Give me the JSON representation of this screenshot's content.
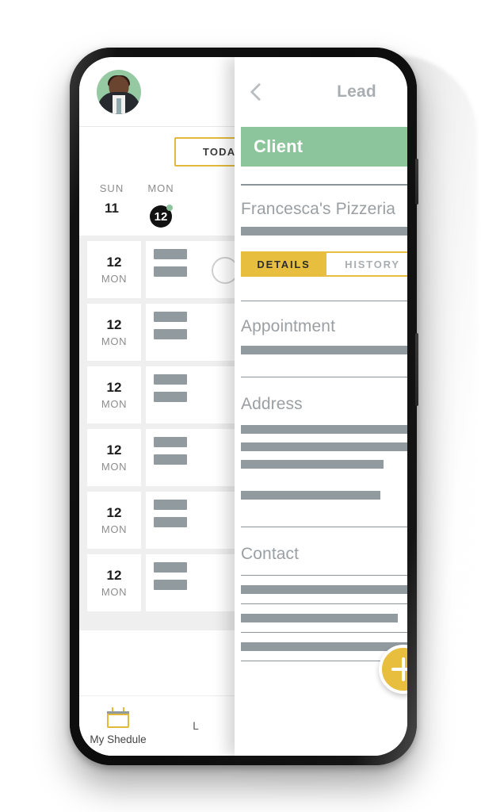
{
  "app": {
    "accent_yellow": "#e7be3e",
    "accent_green": "#8cc49b",
    "skeleton_gray": "#919a9e",
    "text_gray": "#9a9fa3"
  },
  "schedule_screen": {
    "avatar_name": "user-avatar",
    "today_button": "TODAY",
    "weekdays": [
      {
        "name": "SUN",
        "number": "11",
        "selected": false,
        "has_dot": false
      },
      {
        "name": "MON",
        "number": "12",
        "selected": true,
        "has_dot": true
      }
    ],
    "appointments": [
      {
        "number": "12",
        "day": "MON"
      },
      {
        "number": "12",
        "day": "MON"
      },
      {
        "number": "12",
        "day": "MON"
      },
      {
        "number": "12",
        "day": "MON"
      },
      {
        "number": "12",
        "day": "MON"
      },
      {
        "number": "12",
        "day": "MON"
      }
    ],
    "bottom_nav": [
      {
        "label": "My Shedule",
        "icon": "calendar-icon",
        "active": true
      },
      {
        "label": "L",
        "icon": "leads-icon",
        "active": false
      }
    ]
  },
  "lead_screen": {
    "header": {
      "back_icon": "chevron-left-icon",
      "title": "Lead"
    },
    "status_banner": "Client",
    "lead_name": "Francesca's Pizzeria",
    "tabs": [
      {
        "label": "DETAILS",
        "active": true
      },
      {
        "label": "HISTORY",
        "active": false
      },
      {
        "label": "",
        "active": false
      }
    ],
    "sections": [
      {
        "title": "Appointment",
        "lines": [
          100
        ]
      },
      {
        "title": "Address",
        "lines": [
          89,
          78,
          62,
          0,
          60
        ]
      },
      {
        "title": "Contact",
        "lines": [
          80,
          72,
          86,
          90
        ]
      }
    ],
    "fab": {
      "icon": "plus-icon",
      "label": "add"
    }
  }
}
